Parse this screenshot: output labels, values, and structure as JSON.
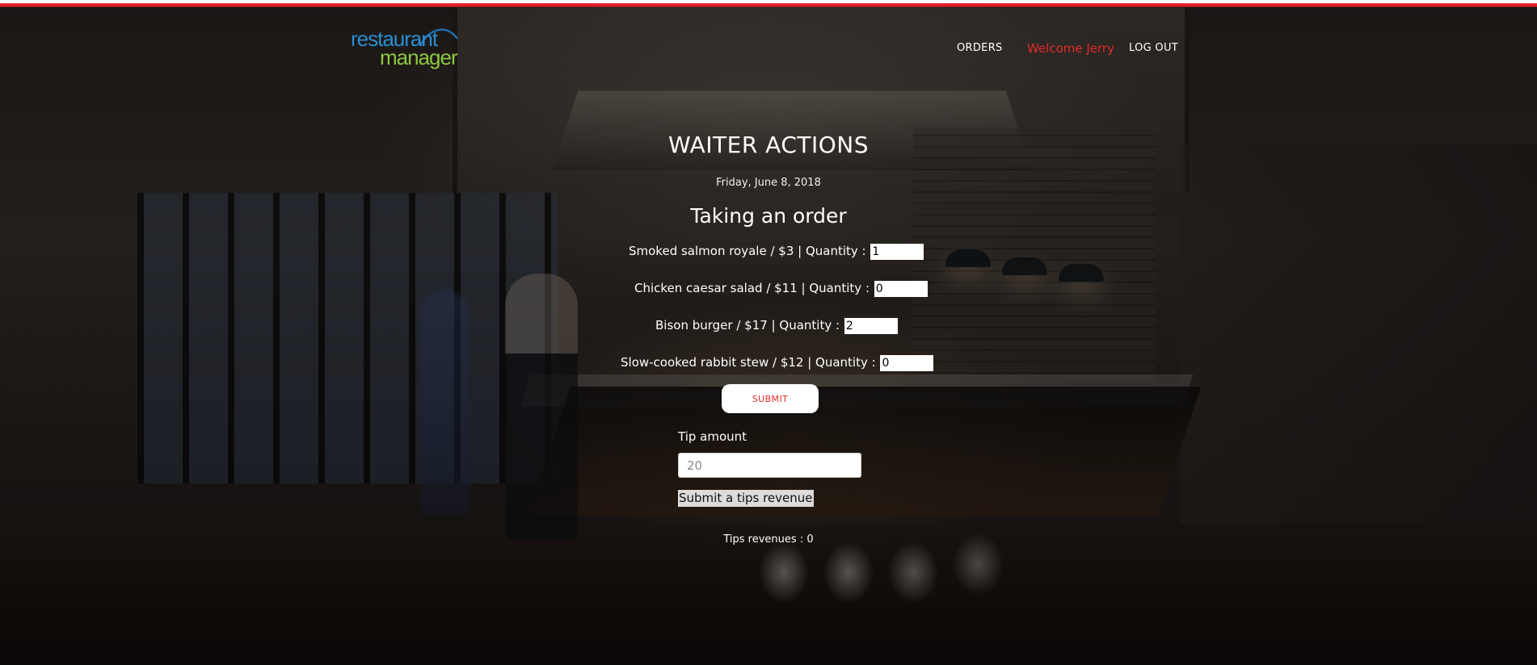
{
  "header": {
    "logo": {
      "line1": "restaurant",
      "line2": "manager"
    },
    "nav": {
      "orders": "ORDERS",
      "welcome": "Welcome Jerry",
      "logout": "LOG OUT"
    },
    "accent_color": "#e22b2b"
  },
  "main": {
    "title": "WAITER ACTIONS",
    "date": "Friday, June 8, 2018",
    "order_section_title": "Taking an order",
    "items": [
      {
        "label": "Smoked salmon royale / $3 | Quantity :",
        "quantity": "1"
      },
      {
        "label": "Chicken caesar salad / $11 | Quantity :",
        "quantity": "0"
      },
      {
        "label": "Bison burger / $17 | Quantity :",
        "quantity": "2"
      },
      {
        "label": "Slow-cooked rabbit stew / $12 | Quantity :",
        "quantity": "0"
      }
    ],
    "submit_label": "SUBMIT",
    "tip": {
      "label": "Tip amount",
      "placeholder": "20",
      "submit_label": "Submit a tips revenue",
      "revenue_text": "Tips revenues : 0"
    }
  }
}
